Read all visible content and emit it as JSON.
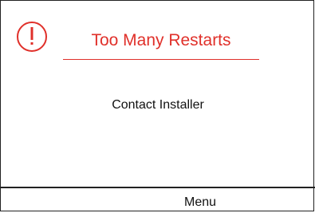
{
  "alert": {
    "icon": "exclamation-circle-icon",
    "title": "Too Many Restarts",
    "accent_color": "#e0302a"
  },
  "message": "Contact Installer",
  "softkeys": {
    "center_label": "Menu"
  }
}
